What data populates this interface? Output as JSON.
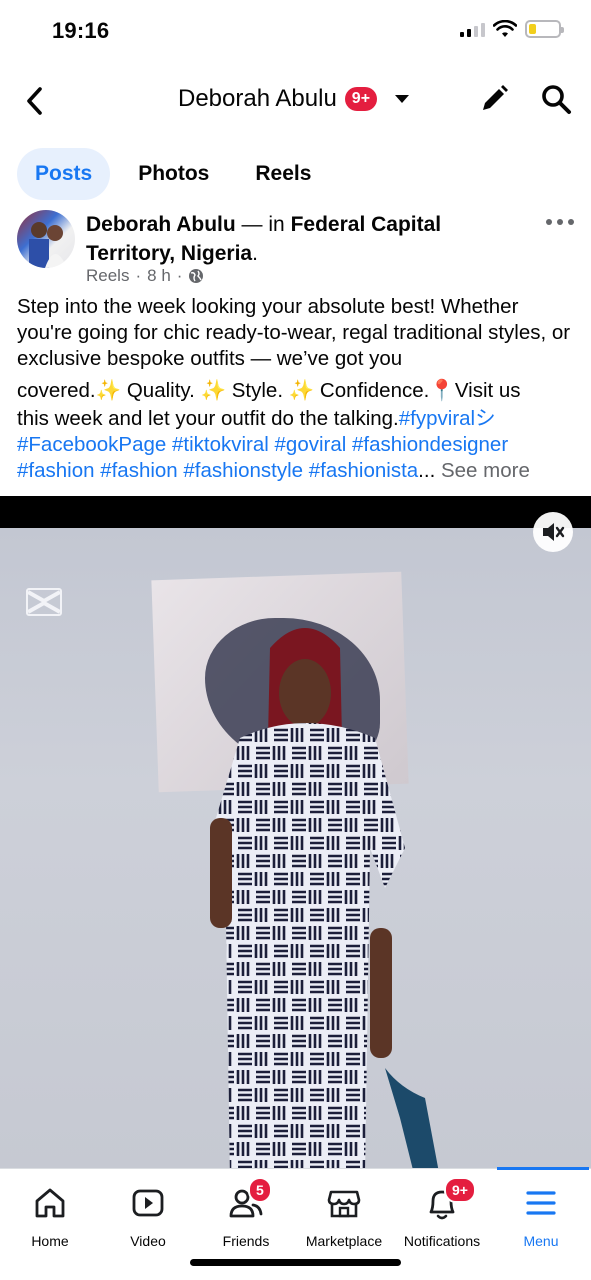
{
  "status_bar": {
    "time": "19:16",
    "battery_level": 0.25
  },
  "header": {
    "title": "Deborah Abulu",
    "badge": "9+",
    "icons": [
      "chevron-left-icon",
      "caret-down-icon",
      "pencil-icon",
      "search-icon"
    ]
  },
  "tabs": [
    {
      "label": "Posts",
      "active": true
    },
    {
      "label": "Photos",
      "active": false
    },
    {
      "label": "Reels",
      "active": false
    }
  ],
  "post": {
    "author": "Deborah Abulu",
    "connector": " — in ",
    "location": "Federal Capital Territory, Nigeria",
    "location_suffix": ".",
    "meta": {
      "source": "Reels",
      "separator": "·",
      "time": "8 h",
      "privacy_icon": "globe-icon"
    },
    "text_lines": [
      "Step into the week looking your absolute best! Whether you're going for chic ready-to-wear, regal traditional styles, or exclusive bespoke outfits — we’ve got you",
      "covered.✨ Quality. ✨ Style. ✨ Confidence.📍Visit us",
      "this week and let your outfit do the talking."
    ],
    "hashtags_line1": "#fypviralシ",
    "hashtags_line2": "#FacebookPage #tiktokviral #goviral #fashiondesigner",
    "hashtags_line3": "#fashion #fashion #fashionstyle #fashionista",
    "ellipsis": "...",
    "see_more": "See more",
    "video_icons": [
      "mute-icon",
      "capcut-logo-icon"
    ]
  },
  "bottom_nav": {
    "items": [
      {
        "label": "Home",
        "icon": "home-icon",
        "badge": ""
      },
      {
        "label": "Video",
        "icon": "video-icon",
        "badge": ""
      },
      {
        "label": "Friends",
        "icon": "friends-icon",
        "badge": "5"
      },
      {
        "label": "Marketplace",
        "icon": "marketplace-icon",
        "badge": ""
      },
      {
        "label": "Notifications",
        "icon": "bell-icon",
        "badge": "9+"
      },
      {
        "label": "Menu",
        "icon": "menu-icon",
        "badge": ""
      }
    ],
    "active": "Menu"
  },
  "colors": {
    "accent": "#1877f2",
    "badge": "#e41e3f",
    "muted": "#65676b"
  }
}
